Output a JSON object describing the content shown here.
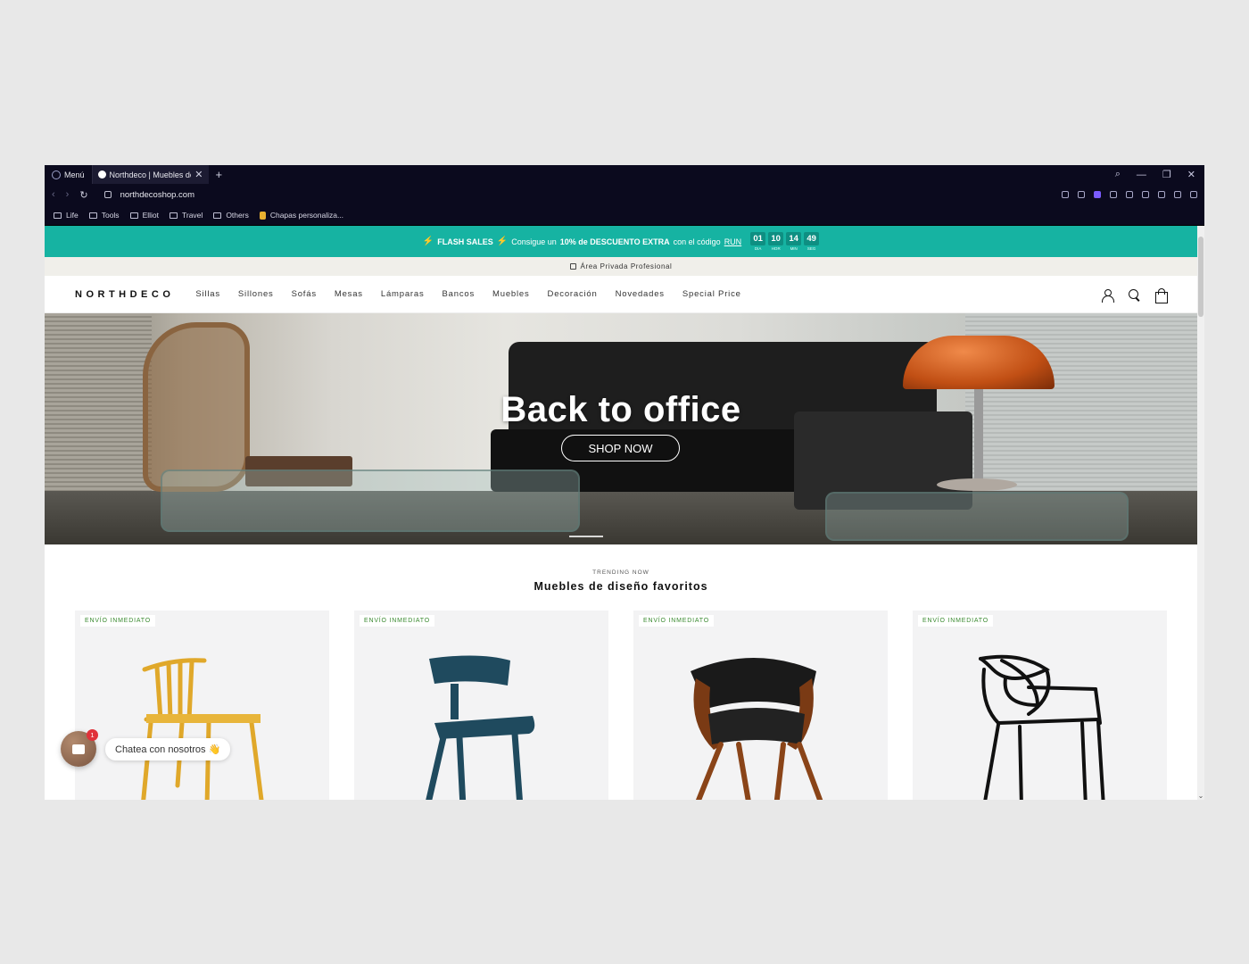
{
  "browser": {
    "menu_label": "Menú",
    "tab_title": "Northdeco | Muebles de D",
    "url": "northdecoshop.com",
    "bookmarks": [
      "Life",
      "Tools",
      "Elliot",
      "Travel",
      "Others",
      "Chapas personaliza..."
    ]
  },
  "promo": {
    "flash_label": "FLASH SALES",
    "text_pre": "Consigue un",
    "text_bold": "10% de DESCUENTO EXTRA",
    "text_post": "con el código",
    "code": "RUN",
    "countdown": [
      {
        "value": "01",
        "label": "DIA"
      },
      {
        "value": "10",
        "label": "HOR"
      },
      {
        "value": "14",
        "label": "MIN"
      },
      {
        "value": "49",
        "label": "SEG"
      }
    ],
    "bolt_color": "#ffd200",
    "bar_color": "#16b3a2"
  },
  "private_area": "Área Privada Profesional",
  "header": {
    "logo": "NORTHDECO",
    "menu": [
      "Sillas",
      "Sillones",
      "Sofás",
      "Mesas",
      "Lámparas",
      "Bancos",
      "Muebles",
      "Decoración",
      "Novedades",
      "Special Price"
    ]
  },
  "hero": {
    "title": "Back to office",
    "cta": "SHOP NOW"
  },
  "trending": {
    "kicker": "TRENDING NOW",
    "title": "Muebles de diseño favoritos",
    "products": [
      {
        "badge": "ENVÍO INMEDIATO",
        "chair_color": "#e0a82a"
      },
      {
        "badge": "ENVÍO INMEDIATO",
        "chair_color": "#1f4a5e"
      },
      {
        "badge": "ENVÍO INMEDIATO",
        "chair_color": "#1a1a1a"
      },
      {
        "badge": "ENVÍO INMEDIATO",
        "chair_color": "#111111"
      }
    ]
  },
  "chat": {
    "badge": "1",
    "label": "Chatea con nosotros 👋"
  }
}
